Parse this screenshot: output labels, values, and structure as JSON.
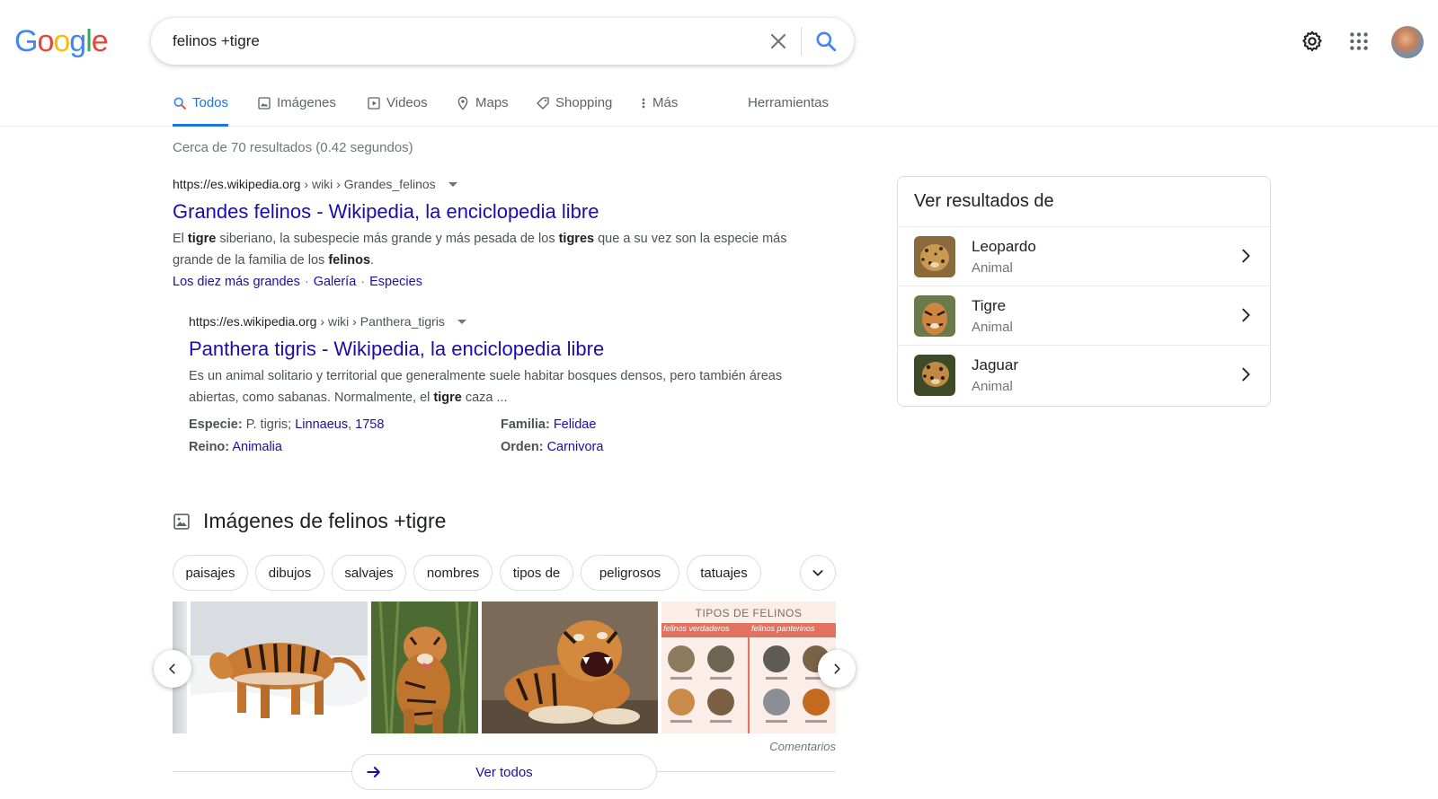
{
  "logo": {
    "letters": [
      "G",
      "o",
      "o",
      "g",
      "l",
      "e"
    ],
    "colors": [
      "#4285F4",
      "#EA4335",
      "#FBBC05",
      "#4285F4",
      "#34A853",
      "#EA4335"
    ]
  },
  "search": {
    "value": "felinos +tigre",
    "placeholder": ""
  },
  "tabs": [
    {
      "label": "Todos",
      "icon": "search-icon",
      "active": true
    },
    {
      "label": "Imágenes",
      "icon": "image-icon"
    },
    {
      "label": "Videos",
      "icon": "play-icon"
    },
    {
      "label": "Maps",
      "icon": "pin-icon"
    },
    {
      "label": "Shopping",
      "icon": "tag-icon"
    },
    {
      "label": "Más",
      "icon": "more-icon"
    }
  ],
  "tools_label": "Herramientas",
  "stats": "Cerca de 70 resultados (0.42 segundos)",
  "results": [
    {
      "domain": "https://es.wikipedia.org",
      "path": "› wiki › Grandes_felinos",
      "title": "Grandes felinos - Wikipedia, la enciclopedia libre",
      "snippet_parts": [
        "El ",
        "tigre",
        " siberiano, la subespecie más grande y más pesada de los ",
        "tigres",
        " que a su vez son la especie más grande de la familia de los ",
        "felinos",
        "."
      ],
      "sitelinks": [
        "Los diez más grandes",
        "Galería",
        "Especies"
      ]
    },
    {
      "domain": "https://es.wikipedia.org",
      "path": "› wiki › Panthera_tigris",
      "title": "Panthera tigris - Wikipedia, la enciclopedia libre",
      "snippet_parts": [
        "Es un animal solitario y territorial que generalmente suele habitar bosques densos, pero también áreas abiertas, como sabanas. Normalmente, el ",
        "tigre",
        " caza ..."
      ],
      "facts": {
        "especie_label": "Especie:",
        "especie_text": "P. tigris;",
        "especie_link1": "Linnaeus",
        "especie_link2": "1758",
        "familia_label": "Familia:",
        "familia_value": "Felidae",
        "reino_label": "Reino:",
        "reino_value": "Animalia",
        "orden_label": "Orden:",
        "orden_value": "Carnivora"
      }
    }
  ],
  "images": {
    "title": "Imágenes de felinos +tigre",
    "chips": [
      "paisajes",
      "dibujos",
      "salvajes",
      "nombres",
      "tipos de",
      "peligrosos",
      "tatuajes"
    ],
    "poster_title": "TIPOS DE FELINOS",
    "poster_tab1": "felinos verdaderos",
    "poster_tab2": "felinos panterinos",
    "comments": "Comentarios",
    "see_all": "Ver todos"
  },
  "knowledge_panel": {
    "title": "Ver resultados de",
    "items": [
      {
        "name": "Leopardo",
        "type": "Animal"
      },
      {
        "name": "Tigre",
        "type": "Animal"
      },
      {
        "name": "Jaguar",
        "type": "Animal"
      }
    ]
  },
  "colors": {
    "link": "#1a0dab",
    "accent": "#1a73e8",
    "muted": "#70757a"
  }
}
